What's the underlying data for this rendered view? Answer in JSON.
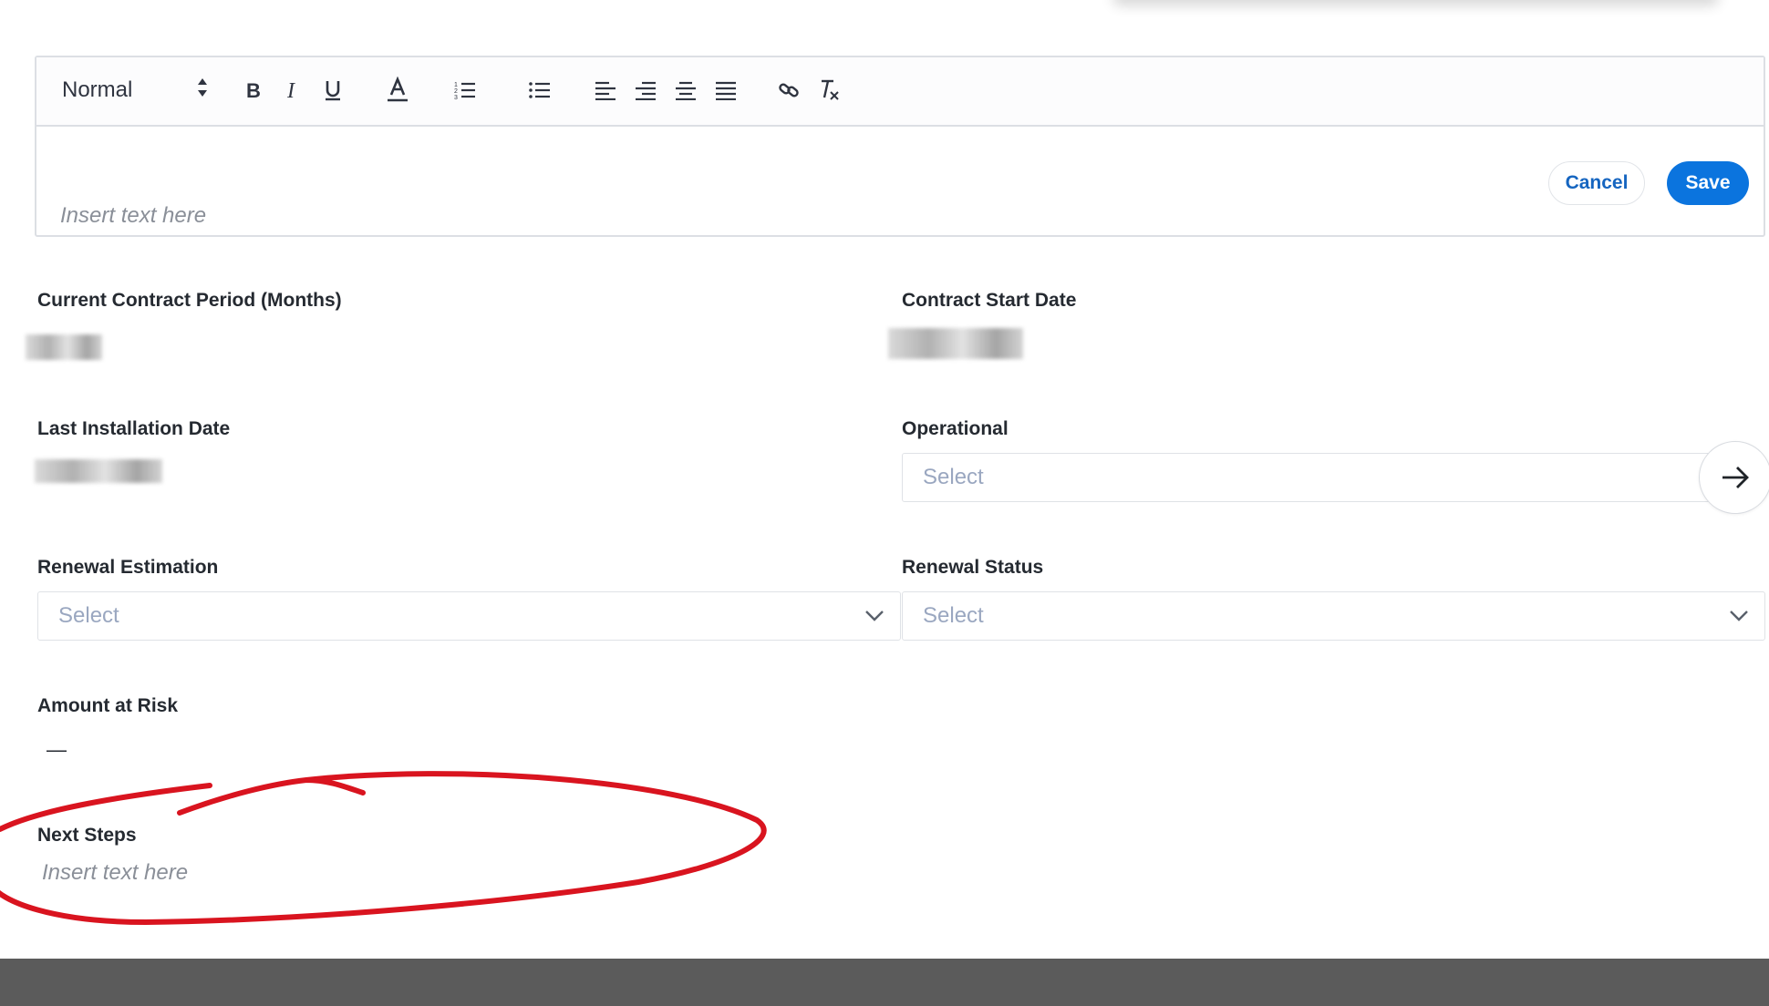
{
  "editor": {
    "format_select": "Normal",
    "placeholder": "Insert text here",
    "cancel_label": "Cancel",
    "save_label": "Save",
    "toolbar_icons": [
      "bold-icon",
      "italic-icon",
      "underline-icon",
      "text-color-icon",
      "ordered-list-icon",
      "bullet-list-icon",
      "align-left-icon",
      "align-right-icon",
      "align-center-icon",
      "align-justify-icon",
      "link-icon",
      "clear-format-icon"
    ]
  },
  "fields": {
    "current_contract_period": {
      "label": "Current Contract Period (Months)"
    },
    "contract_start_date": {
      "label": "Contract Start Date"
    },
    "last_installation_date": {
      "label": "Last Installation Date"
    },
    "operational": {
      "label": "Operational",
      "placeholder": "Select"
    },
    "renewal_estimation": {
      "label": "Renewal Estimation",
      "placeholder": "Select"
    },
    "renewal_status": {
      "label": "Renewal Status",
      "placeholder": "Select"
    },
    "amount_at_risk": {
      "label": "Amount at Risk",
      "value": "—"
    },
    "next_steps": {
      "label": "Next Steps",
      "placeholder": "Insert text here"
    }
  },
  "colors": {
    "accent": "#0b74de",
    "link": "#1565c0",
    "annotation": "#d9141f",
    "placeholder": "#9aa7c0"
  }
}
